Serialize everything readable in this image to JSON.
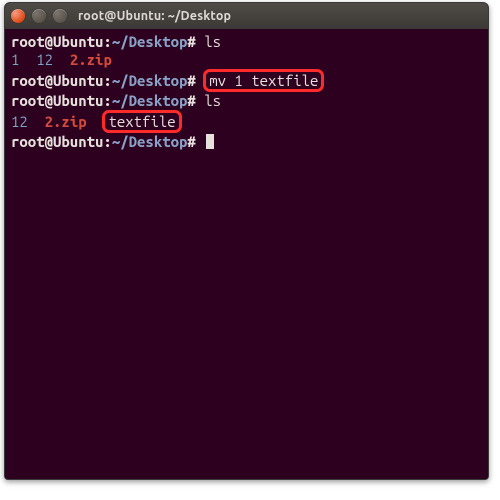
{
  "window": {
    "title": "root@Ubuntu: ~/Desktop"
  },
  "prompt": {
    "user_host": "root@Ubuntu",
    "colon": ":",
    "path": "~/Desktop",
    "symbol": "#"
  },
  "lines": {
    "l1_cmd": "ls",
    "l2_a": "1",
    "l2_b": "12",
    "l2_zip": "2.zip",
    "l3_cmd": "mv 1 textfile",
    "l4_cmd": "ls",
    "l5_a": "12",
    "l5_zip": "2.zip",
    "l5_txt": "textfile"
  }
}
